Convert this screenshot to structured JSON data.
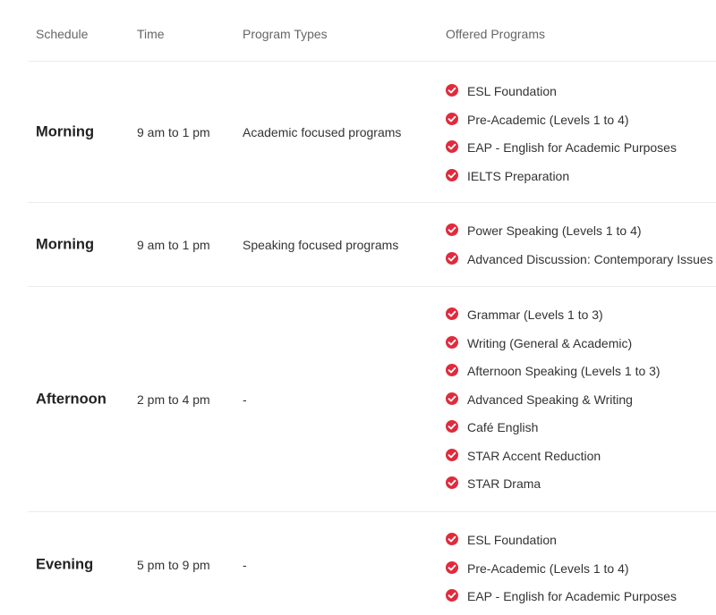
{
  "header": {
    "schedule": "Schedule",
    "time": "Time",
    "program_types": "Program Types",
    "offered_programs": "Offered Programs"
  },
  "colors": {
    "check_icon": "#e02b3c",
    "divider": "#ececec"
  },
  "rows": [
    {
      "schedule": "Morning",
      "time": "9 am to 1 pm",
      "type": "Academic focused programs",
      "programs": [
        "ESL Foundation",
        "Pre-Academic (Levels 1 to 4)",
        "EAP - English for Academic Purposes",
        "IELTS Preparation"
      ]
    },
    {
      "schedule": "Morning",
      "time": "9 am to 1 pm",
      "type": "Speaking focused programs",
      "programs": [
        "Power Speaking (Levels 1 to 4)",
        "Advanced Discussion: Contemporary Issues"
      ]
    },
    {
      "schedule": "Afternoon",
      "time": "2 pm to 4 pm",
      "type": "-",
      "programs": [
        "Grammar (Levels 1 to 3)",
        "Writing (General & Academic)",
        "Afternoon Speaking (Levels 1 to 3)",
        "Advanced Speaking & Writing",
        "Café English",
        "STAR Accent Reduction",
        "STAR Drama"
      ]
    },
    {
      "schedule": "Evening",
      "time": "5 pm to 9 pm",
      "type": "-",
      "programs": [
        "ESL Foundation",
        "Pre-Academic (Levels 1 to 4)",
        "EAP - English for Academic Purposes"
      ]
    }
  ]
}
